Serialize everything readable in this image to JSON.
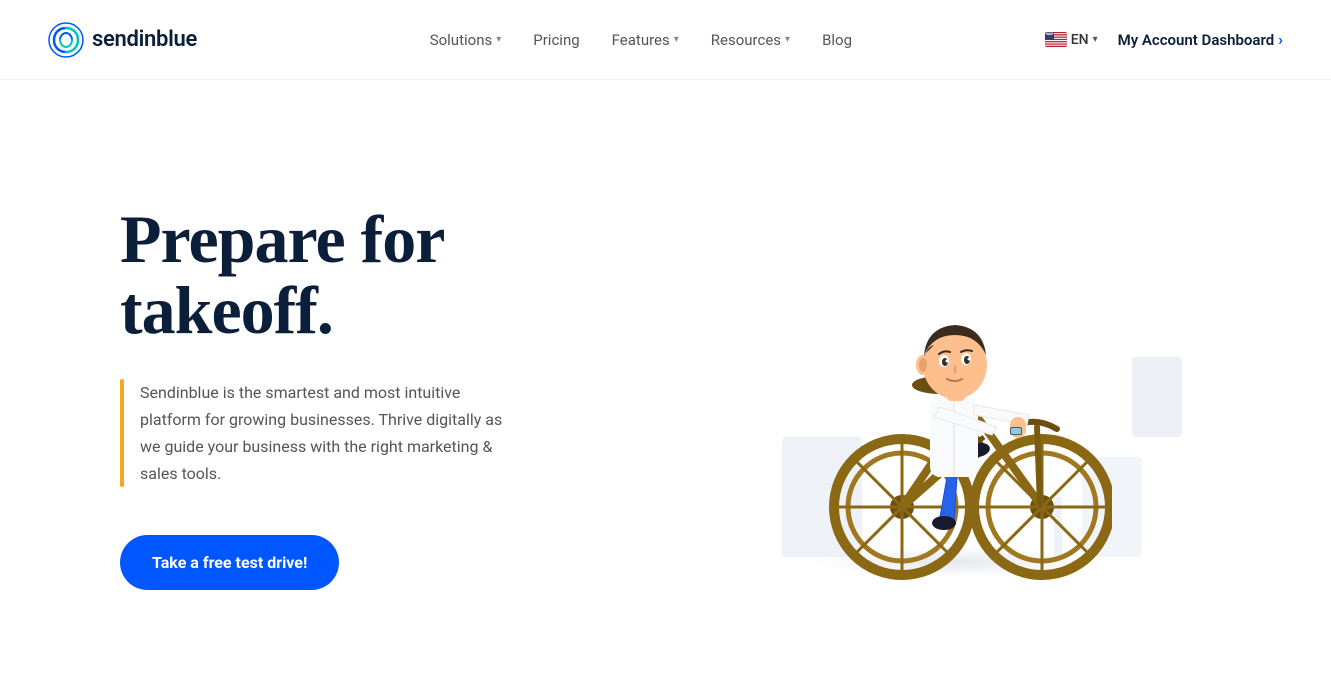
{
  "header": {
    "logo": {
      "text": "sendinblue",
      "alt": "Sendinblue logo"
    },
    "nav": {
      "items": [
        {
          "label": "Solutions",
          "hasDropdown": true
        },
        {
          "label": "Pricing",
          "hasDropdown": false
        },
        {
          "label": "Features",
          "hasDropdown": true
        },
        {
          "label": "Resources",
          "hasDropdown": true
        },
        {
          "label": "Blog",
          "hasDropdown": false
        }
      ]
    },
    "language": {
      "code": "EN",
      "label": "EN"
    },
    "account": {
      "label": "My Account Dashboard"
    }
  },
  "hero": {
    "title": "Prepare for takeoff.",
    "description": "Sendinblue is the smartest and most intuitive platform for growing businesses. Thrive digitally as we guide your business with the right marketing & sales tools.",
    "cta_label": "Take a free test drive!"
  }
}
